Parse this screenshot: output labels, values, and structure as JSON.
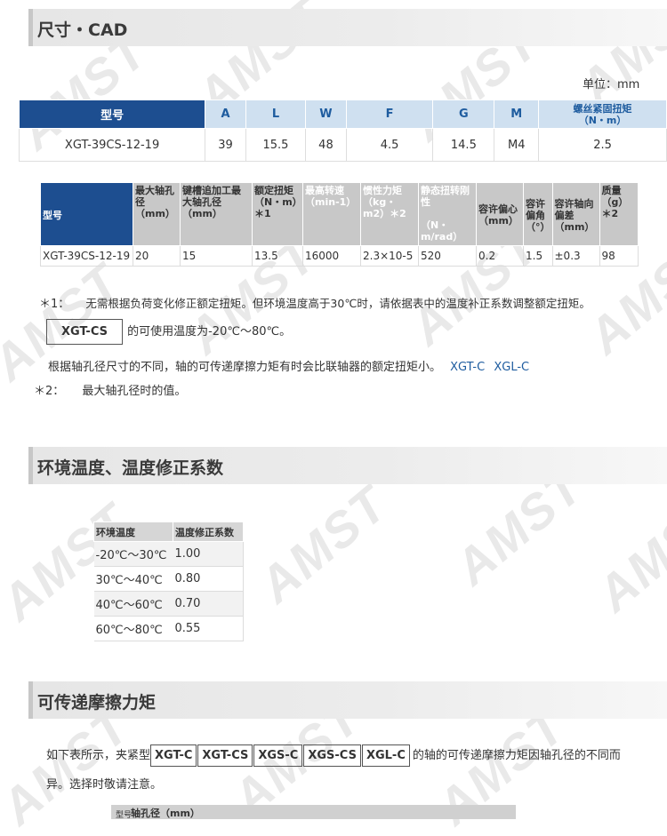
{
  "watermark": "AMST",
  "sections": {
    "cad": "尺寸・CAD",
    "temp": "环境温度、温度修正系数",
    "friction": "可传递摩擦力矩"
  },
  "unit_label": "单位：mm",
  "dim_table": {
    "headers": [
      "型号",
      "A",
      "L",
      "W",
      "F",
      "G",
      "M",
      "螺丝紧固扭矩\n（N・m）"
    ],
    "row": [
      "XGT-39CS-12-19",
      "39",
      "15.5",
      "48",
      "4.5",
      "14.5",
      "M4",
      "2.5"
    ]
  },
  "spec_table": {
    "headers": [
      "型号",
      "最大轴孔径（mm）",
      "键槽追加工最大轴孔径（mm）",
      "额定扭矩（N・m）＊1",
      "最高转速（min-1）",
      "惯性力矩（kg・m2）＊2",
      "静态扭转刚性\n\n（N・m/rad）",
      "容许偏心（mm）",
      "容许偏角（°）",
      "容许轴向偏差（mm）",
      "质量（g）＊2"
    ],
    "row": [
      "XGT-39CS-12-19",
      "20",
      "15",
      "13.5",
      "16000",
      "2.3×10-5",
      "520",
      "0.2",
      "1.5",
      "±0.3",
      "98"
    ]
  },
  "notes": {
    "n1_mark": "＊1：",
    "n1_text": "无需根据负荷变化修正额定扭矩。但环境温度高于30℃时，请依据表中的温度补正系数调整额定扭矩。",
    "model_box": "XGT-CS",
    "temp_range": "的可使用温度为-20℃～80℃。",
    "friction_note": "根据轴孔径尺寸的不同，轴的可传递摩擦力矩有时会比联轴器的额定扭矩小。",
    "link1": "XGT-C",
    "link2": "XGL-C",
    "n2_mark": "＊2：",
    "n2_text": "最大轴孔径时的值。"
  },
  "temp_table": {
    "headers": [
      "环境温度",
      "温度修正系数"
    ],
    "rows": [
      [
        "-20℃～30℃",
        "1.00"
      ],
      [
        "30℃～40℃",
        "0.80"
      ],
      [
        "40℃～60℃",
        "0.70"
      ],
      [
        "60℃～80℃",
        "0.55"
      ]
    ]
  },
  "friction": {
    "prefix": "如下表所示，夹紧型",
    "models": [
      "XGT-C",
      "XGT-CS",
      "XGS-C",
      "XGS-CS",
      "XGL-C"
    ],
    "suffix_1": "的轴的可传递摩擦力矩因轴孔径的不同而",
    "suffix_2": "异。选择时敬请注意。",
    "shaft_header": "轴孔径（mm）",
    "row_label": "型号"
  }
}
